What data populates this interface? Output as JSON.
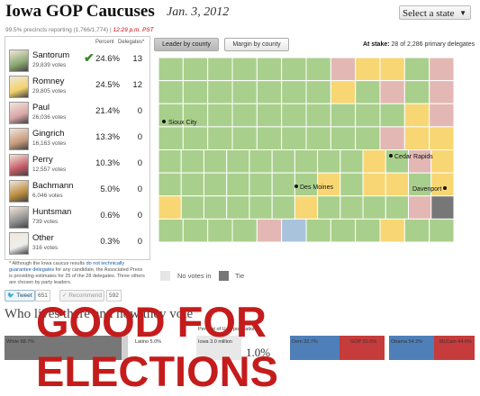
{
  "header": {
    "title": "Iowa GOP Caucuses",
    "date": "Jan. 3, 2012",
    "state_select": "Select a state"
  },
  "status": {
    "precincts": "99.5% precincts reporting (1,766/1,774)",
    "time": "12:29 p.m. PST"
  },
  "table": {
    "percent_header": "Percent",
    "delegates_header": "Delegates*",
    "candidates": [
      {
        "name": "Santorum",
        "votes": "29,839 votes",
        "pct": "24.6%",
        "del": "13",
        "winner": true,
        "color": "#8aa870"
      },
      {
        "name": "Romney",
        "votes": "29,805 votes",
        "pct": "24.5%",
        "del": "12",
        "winner": false,
        "color": "#f3d26a"
      },
      {
        "name": "Paul",
        "votes": "26,036 votes",
        "pct": "21.4%",
        "del": "0",
        "winner": false,
        "color": "#d8a6a6"
      },
      {
        "name": "Gingrich",
        "votes": "16,163 votes",
        "pct": "13.3%",
        "del": "0",
        "winner": false,
        "color": "#c79a7c"
      },
      {
        "name": "Perry",
        "votes": "12,557 votes",
        "pct": "10.3%",
        "del": "0",
        "winner": false,
        "color": "#c45b66"
      },
      {
        "name": "Bachmann",
        "votes": "6,046 votes",
        "pct": "5.0%",
        "del": "0",
        "winner": false,
        "color": "#b98b3e"
      },
      {
        "name": "Huntsman",
        "votes": "739 votes",
        "pct": "0.6%",
        "del": "0",
        "winner": false,
        "color": "#8f8f8f"
      },
      {
        "name": "Other",
        "votes": "316 votes",
        "pct": "0.3%",
        "del": "0",
        "winner": false,
        "color": "#eeeeee"
      }
    ],
    "footnote_a": "* Although the Iowa caucus results ",
    "footnote_link": "do not technically guarantee delegates",
    "footnote_b": " for any candidate, the Associated Press is providing estimates for 25 of the 28 delegates. Three others are chosen by party leaders."
  },
  "map_controls": {
    "leader_label": "Leader by county",
    "margin_label": "Margin by county",
    "stake_label": "At stake:",
    "stake_text": "28 of 2,286 primary delegates"
  },
  "map": {
    "cities": [
      "Sioux City",
      "Des Moines",
      "Cedar Rapids",
      "Davenport"
    ],
    "colors": {
      "santorum": "#a9cf8c",
      "romney": "#f7d673",
      "paul": "#e3b8b4",
      "tie": "#777777",
      "novotes": "#e6e6e6",
      "blue": "#a9c3dd"
    }
  },
  "legend": {
    "no_votes": "No votes in",
    "tie": "Tie"
  },
  "social": {
    "tweet": "Tweet",
    "tweet_count": "651",
    "recommend": "Recommend",
    "recommend_count": "592"
  },
  "who": {
    "heading": "Who lives there and how they vote"
  },
  "banner": "GOOD FOR ELECTIONS",
  "strips": {
    "white": "White 88.7%",
    "latino": "Latino 5.0%",
    "population_head": "Percent of U.S. population",
    "iowa_pop": "Iowa 3.0 million",
    "pop_pct": "1.0%",
    "dem": "Dem 32.7%",
    "gop": "GOP 31.0%",
    "obama": "Obama 54.2%",
    "mccain": "McCain 44.6%"
  }
}
